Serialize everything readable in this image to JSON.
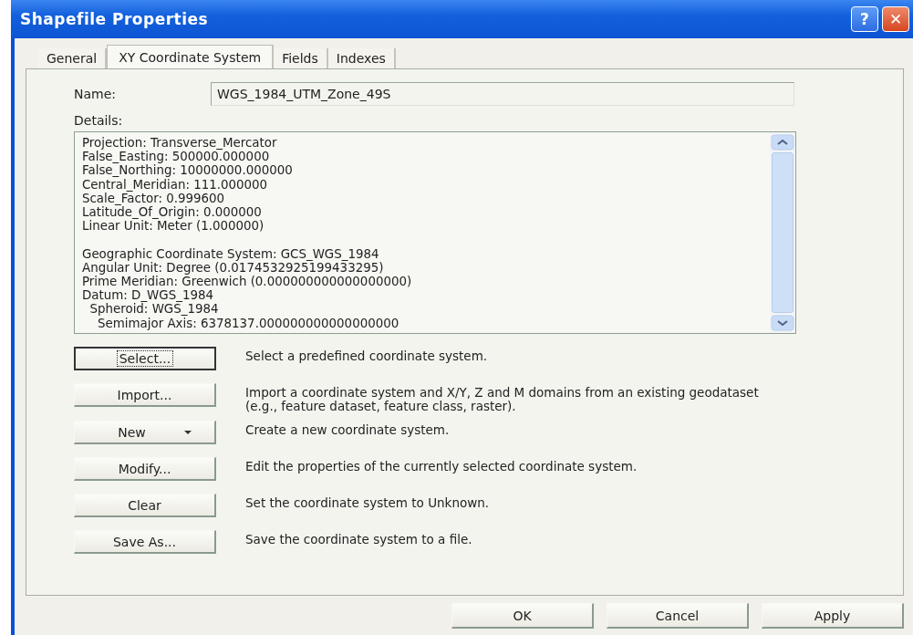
{
  "window": {
    "title": "Shapefile Properties",
    "controls": [
      {
        "kind": "help",
        "label": "?"
      },
      {
        "kind": "close",
        "label": "✕"
      }
    ]
  },
  "tabs": [
    {
      "label": "General",
      "selected": false
    },
    {
      "label": "XY Coordinate System",
      "selected": true
    },
    {
      "label": "Fields",
      "selected": false
    },
    {
      "label": "Indexes",
      "selected": false
    }
  ],
  "name": {
    "label": "Name:",
    "value": "WGS_1984_UTM_Zone_49S"
  },
  "details": {
    "label": "Details:",
    "groups": [
      [
        "Projection: Transverse_Mercator",
        "False_Easting: 500000.000000",
        "False_Northing: 10000000.000000",
        "Central_Meridian: 111.000000",
        "Scale_Factor: 0.999600",
        "Latitude_Of_Origin: 0.000000",
        "Linear Unit: Meter (1.000000)"
      ],
      [
        "Geographic Coordinate System: GCS_WGS_1984",
        "Angular Unit: Degree (0.0174532925199433295)",
        "Prime Meridian: Greenwich (0.000000000000000000)",
        "Datum: D_WGS_1984",
        "  Spheroid: WGS_1984",
        "    Semimajor Axis: 6378137.000000000000000000"
      ]
    ]
  },
  "actions": [
    {
      "button": "Select...",
      "focused": true,
      "dropdown": false,
      "description": "Select a predefined coordinate system."
    },
    {
      "button": "Import...",
      "focused": false,
      "dropdown": false,
      "description": "Import a coordinate system and X/Y, Z and M domains from an existing geodataset (e.g., feature dataset, feature class, raster)."
    },
    {
      "button": "New",
      "focused": false,
      "dropdown": true,
      "description": "Create a new coordinate system."
    },
    {
      "button": "Modify...",
      "focused": false,
      "dropdown": false,
      "description": "Edit the properties of the currently selected coordinate system."
    },
    {
      "button": "Clear",
      "focused": false,
      "dropdown": false,
      "description": "Set the coordinate system to Unknown."
    },
    {
      "button": "Save As...",
      "focused": false,
      "dropdown": false,
      "description": "Save the coordinate system to a file."
    }
  ],
  "buttons": [
    "OK",
    "Cancel",
    "Apply"
  ]
}
